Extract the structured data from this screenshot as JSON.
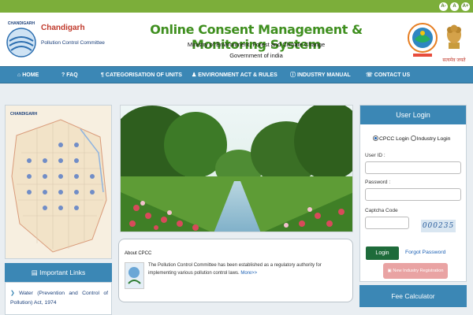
{
  "colors": {
    "accent": "#3b87b5",
    "brand_green": "#3f8f1f",
    "org_red": "#c0392b"
  },
  "font_controls": [
    "A-",
    "A",
    "A+"
  ],
  "header": {
    "org_name": "Chandigarh",
    "org_sub": "Pollution Control Committee",
    "logo_text": "CHANDIGARH",
    "title": "Online Consent Management & Monitoring System",
    "subtitle1": "Ministry of Environment, Forest and Climate Change",
    "subtitle2": "Government of india",
    "emblem_text": "सत्यमेव जयते"
  },
  "nav": [
    {
      "icon": "home-icon",
      "label": "HOME"
    },
    {
      "icon": "question-icon",
      "label": "FAQ"
    },
    {
      "icon": "category-icon",
      "label": "CATEGORISATION OF UNITS"
    },
    {
      "icon": "user-icon",
      "label": "ENVIRONMENT ACT & RULES"
    },
    {
      "icon": "info-icon",
      "label": "INDUSTRY MANUAL"
    },
    {
      "icon": "phone-icon",
      "label": "CONTACT US"
    }
  ],
  "map": {
    "label": "CHANDIGARH"
  },
  "links": {
    "heading": "Important Links",
    "items": [
      "Water (Prevention and Control of Pollution) Act, 1974"
    ]
  },
  "about": {
    "title": "About CPCC",
    "text": "The Pollution Control Committee has been established as a regulatory authority for implementing various pollution control laws.",
    "more": "More>>"
  },
  "login": {
    "heading": "User Login",
    "radio_cpcc": "CPCC Login",
    "radio_industry": "Industry Login",
    "userid_label": "User ID :",
    "password_label": "Password :",
    "captcha_label": "Captcha Code",
    "captcha_value": "000235",
    "login_button": "Login",
    "forgot": "Forgot Password",
    "new_registration": "New Industry Registration"
  },
  "fee": {
    "heading": "Fee Calculator"
  }
}
